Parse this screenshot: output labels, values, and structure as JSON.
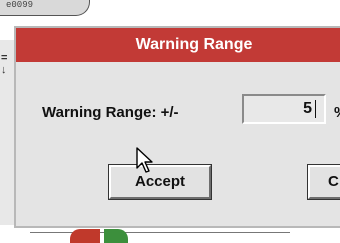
{
  "background": {
    "top_strip_text": "e0099",
    "left_glyph": "=\n↓"
  },
  "dialog": {
    "title": "Warning Range",
    "range_label": "Warning Range: +/-",
    "range_value": "5",
    "unit_label": "%",
    "accept_label": "Accept",
    "cancel_label": "C"
  },
  "colors": {
    "titlebar": "#c23a36",
    "dialog_bg": "#e4e4e4"
  }
}
